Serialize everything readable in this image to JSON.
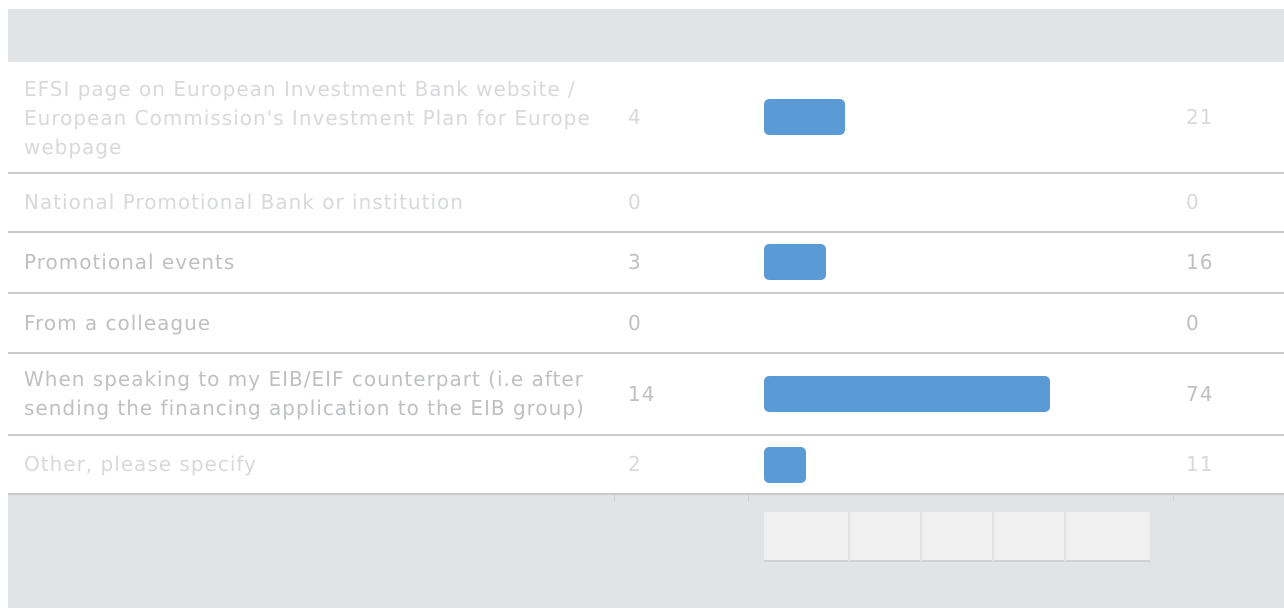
{
  "chart_data": {
    "type": "bar",
    "orientation": "horizontal",
    "categories": [
      "EFSI page on European Investment Bank website / European Commission's Investment Plan for Europe webpage",
      "National Promotional Bank or institution",
      "Promotional events",
      "From a colleague",
      "When speaking to my EIB/EIF counterpart (i.e after sending the financing application to the EIB group)",
      "Other, please specify"
    ],
    "series": [
      {
        "values": [
          4,
          0,
          3,
          0,
          14,
          2
        ]
      },
      {
        "values": [
          21,
          0,
          16,
          0,
          74,
          11
        ]
      }
    ],
    "percent_max": 100,
    "bar_color": "#5b9bd5"
  }
}
